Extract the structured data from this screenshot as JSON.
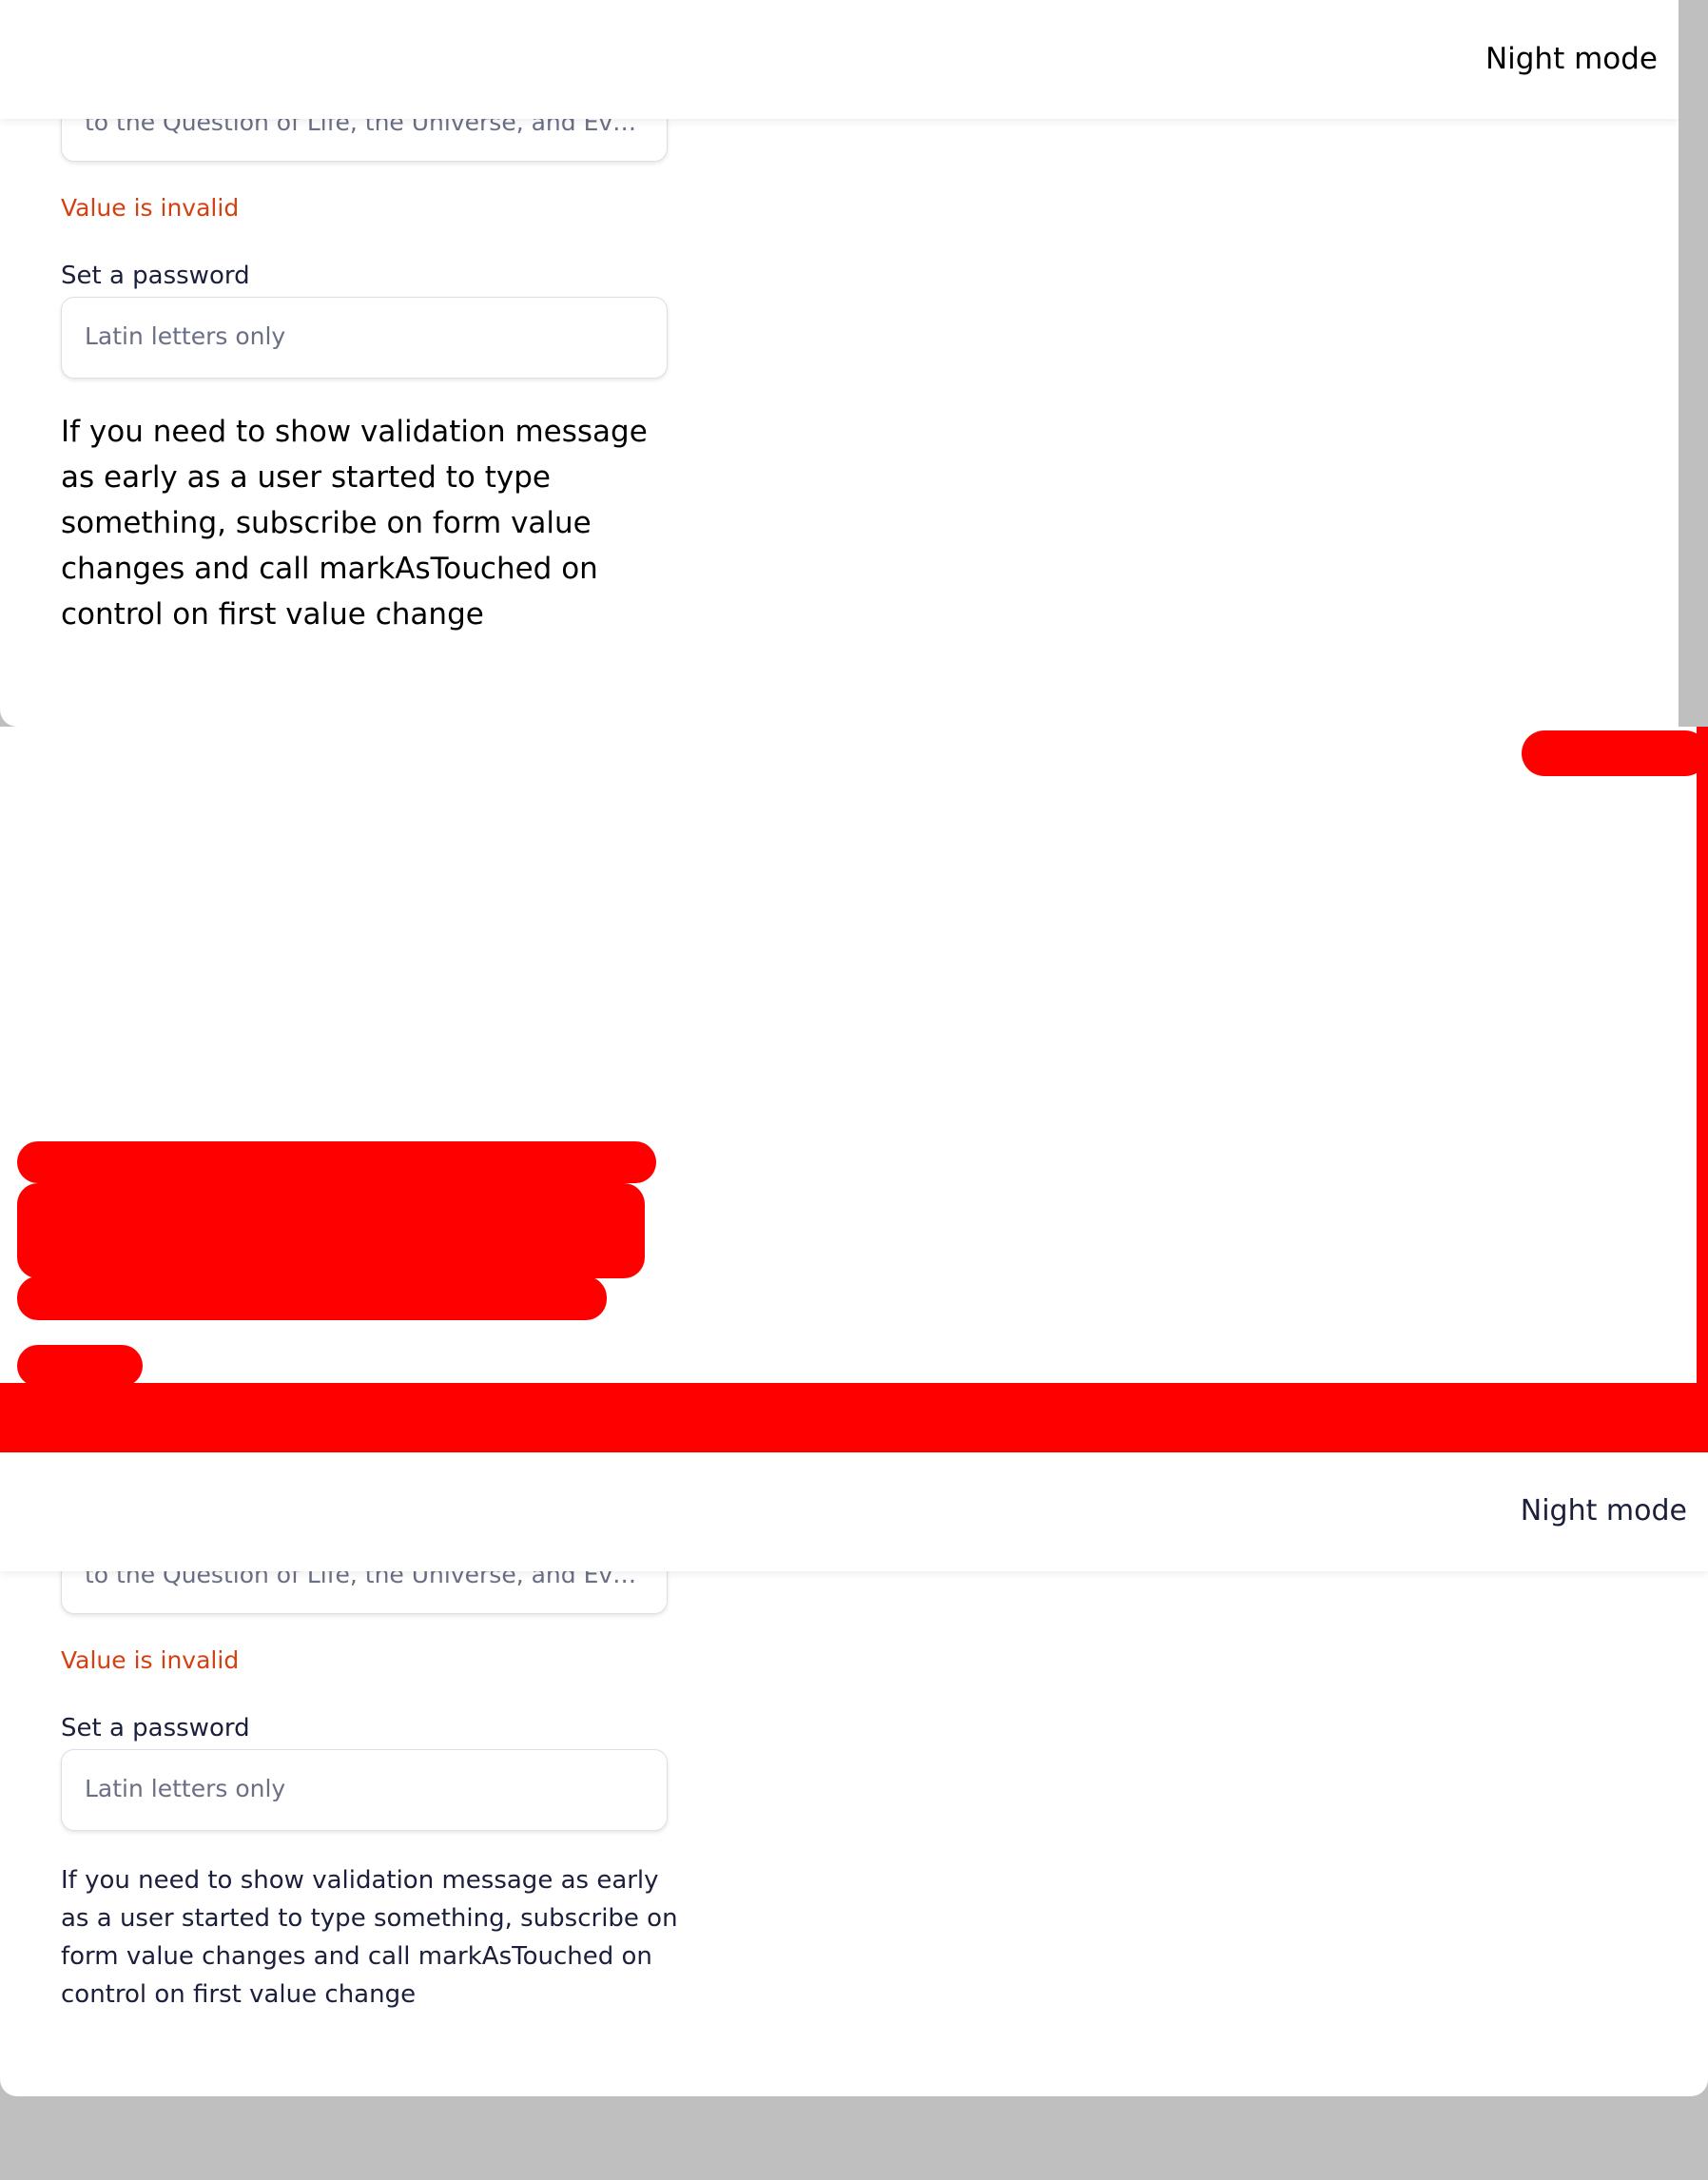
{
  "header": {
    "night_mode_label": "Night mode"
  },
  "form": {
    "answer_field": {
      "placeholder": "to the Question of Life, the Universe, and Every…"
    },
    "answer_error": "Value is invalid",
    "password_label": "Set a password",
    "password_field": {
      "placeholder": "Latin letters only"
    },
    "help_text": "If you need to show validation message as early as a user started to type something, subscribe on form value changes and call markAsTouched on control on first value change"
  },
  "colors": {
    "error": "#d63f0f",
    "redaction": "#ff0000",
    "backdrop": "#bfbfbf"
  }
}
